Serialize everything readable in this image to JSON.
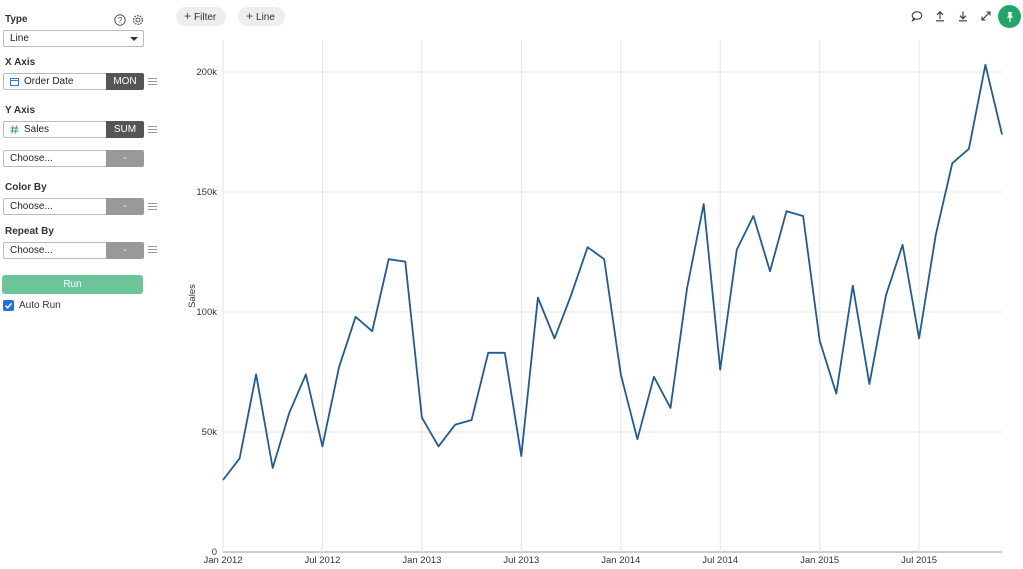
{
  "sidebar": {
    "type_label": "Type",
    "type_value": "Line",
    "x_axis": {
      "label": "X Axis",
      "field": "Order Date",
      "agg": "MON",
      "field_icon": "calendar-icon"
    },
    "y_axis": {
      "label": "Y Axis",
      "field": "Sales",
      "agg": "SUM",
      "field_icon": "hash-icon",
      "extra_placeholder": "Choose...",
      "extra_agg": "-"
    },
    "color_by": {
      "label": "Color By",
      "placeholder": "Choose...",
      "agg": "-"
    },
    "repeat_by": {
      "label": "Repeat By",
      "placeholder": "Choose...",
      "agg": "-"
    },
    "run_label": "Run",
    "auto_run_label": "Auto Run",
    "auto_run_checked": true
  },
  "toolbar": {
    "filter_label": "Filter",
    "line_label": "Line",
    "icons": [
      "comment-icon",
      "upload-icon",
      "download-icon",
      "expand-icon",
      "pin-icon"
    ]
  },
  "colors": {
    "line": "#1f5b96",
    "accent": "#21a56b",
    "run": "#6cc59a"
  },
  "chart_data": {
    "type": "line",
    "ylabel": "Sales",
    "xlabel": "",
    "ylim": [
      0,
      200000
    ],
    "y_ticks": [
      0,
      50000,
      100000,
      150000,
      200000
    ],
    "y_tick_labels": [
      "0",
      "50k",
      "100k",
      "150k",
      "200k"
    ],
    "x_ticks": [
      "2012-01",
      "2012-07",
      "2013-01",
      "2013-07",
      "2014-01",
      "2014-07",
      "2015-01",
      "2015-07"
    ],
    "x_tick_labels": [
      "Jan 2012",
      "Jul 2012",
      "Jan 2013",
      "Jul 2013",
      "Jan 2014",
      "Jul 2014",
      "Jan 2015",
      "Jul 2015"
    ],
    "grid": true,
    "x": [
      "2012-01",
      "2012-02",
      "2012-03",
      "2012-04",
      "2012-05",
      "2012-06",
      "2012-07",
      "2012-08",
      "2012-09",
      "2012-10",
      "2012-11",
      "2012-12",
      "2013-01",
      "2013-02",
      "2013-03",
      "2013-04",
      "2013-05",
      "2013-06",
      "2013-07",
      "2013-08",
      "2013-09",
      "2013-10",
      "2013-11",
      "2013-12",
      "2014-01",
      "2014-02",
      "2014-03",
      "2014-04",
      "2014-05",
      "2014-06",
      "2014-07",
      "2014-08",
      "2014-09",
      "2014-10",
      "2014-11",
      "2014-12",
      "2015-01",
      "2015-02",
      "2015-03",
      "2015-04",
      "2015-05",
      "2015-06",
      "2015-07",
      "2015-08",
      "2015-09",
      "2015-10",
      "2015-11",
      "2015-12"
    ],
    "values": [
      30000,
      39000,
      74000,
      35000,
      58000,
      74000,
      44000,
      77000,
      98000,
      92000,
      122000,
      121000,
      56000,
      44000,
      53000,
      55000,
      83000,
      83000,
      40000,
      106000,
      89000,
      107000,
      127000,
      122000,
      74000,
      47000,
      73000,
      60000,
      110000,
      145000,
      76000,
      126000,
      140000,
      117000,
      142000,
      140000,
      88000,
      66000,
      111000,
      70000,
      107000,
      128000,
      89000,
      132000,
      162000,
      168000,
      203000,
      174000
    ]
  }
}
